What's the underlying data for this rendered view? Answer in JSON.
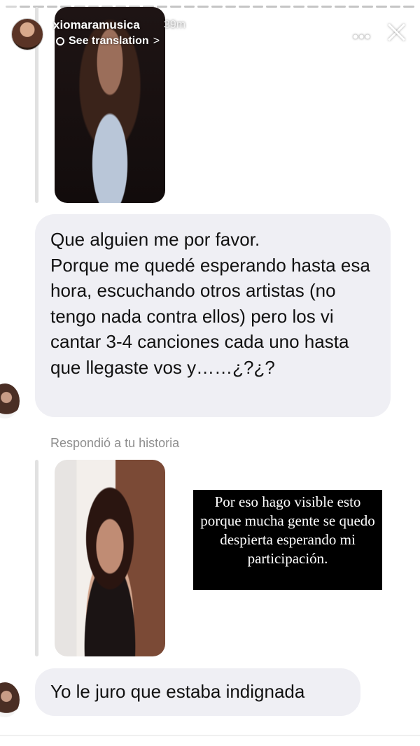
{
  "story": {
    "progress_segments_total": 30,
    "progress_segments_filled": 1
  },
  "header": {
    "username": "xiomaramusica",
    "time": "39m",
    "translate_label": "See translation",
    "translate_chevron": ">",
    "more_icon": "•••",
    "close_icon": "close-icon"
  },
  "messages": {
    "bubble1_text": "Que alguien me por favor.\nPorque me quedé esperando hasta esa hora, escuchando otros artistas (no tengo nada contra ellos) pero los vi cantar 3-4 canciones cada uno hasta que llegaste vos y……¿?¿?",
    "replied_label": "Respondió a tu historia",
    "bubble2_text": "Yo le juro que estaba indignada"
  },
  "overlay": {
    "text": "Por eso hago visible esto porque mucha gente se quedo despierta esperando mi participación."
  },
  "colors": {
    "bubble": "#efeff4",
    "meta_text": "#8e8e8e",
    "reply_bar": "#e1e1e1"
  }
}
